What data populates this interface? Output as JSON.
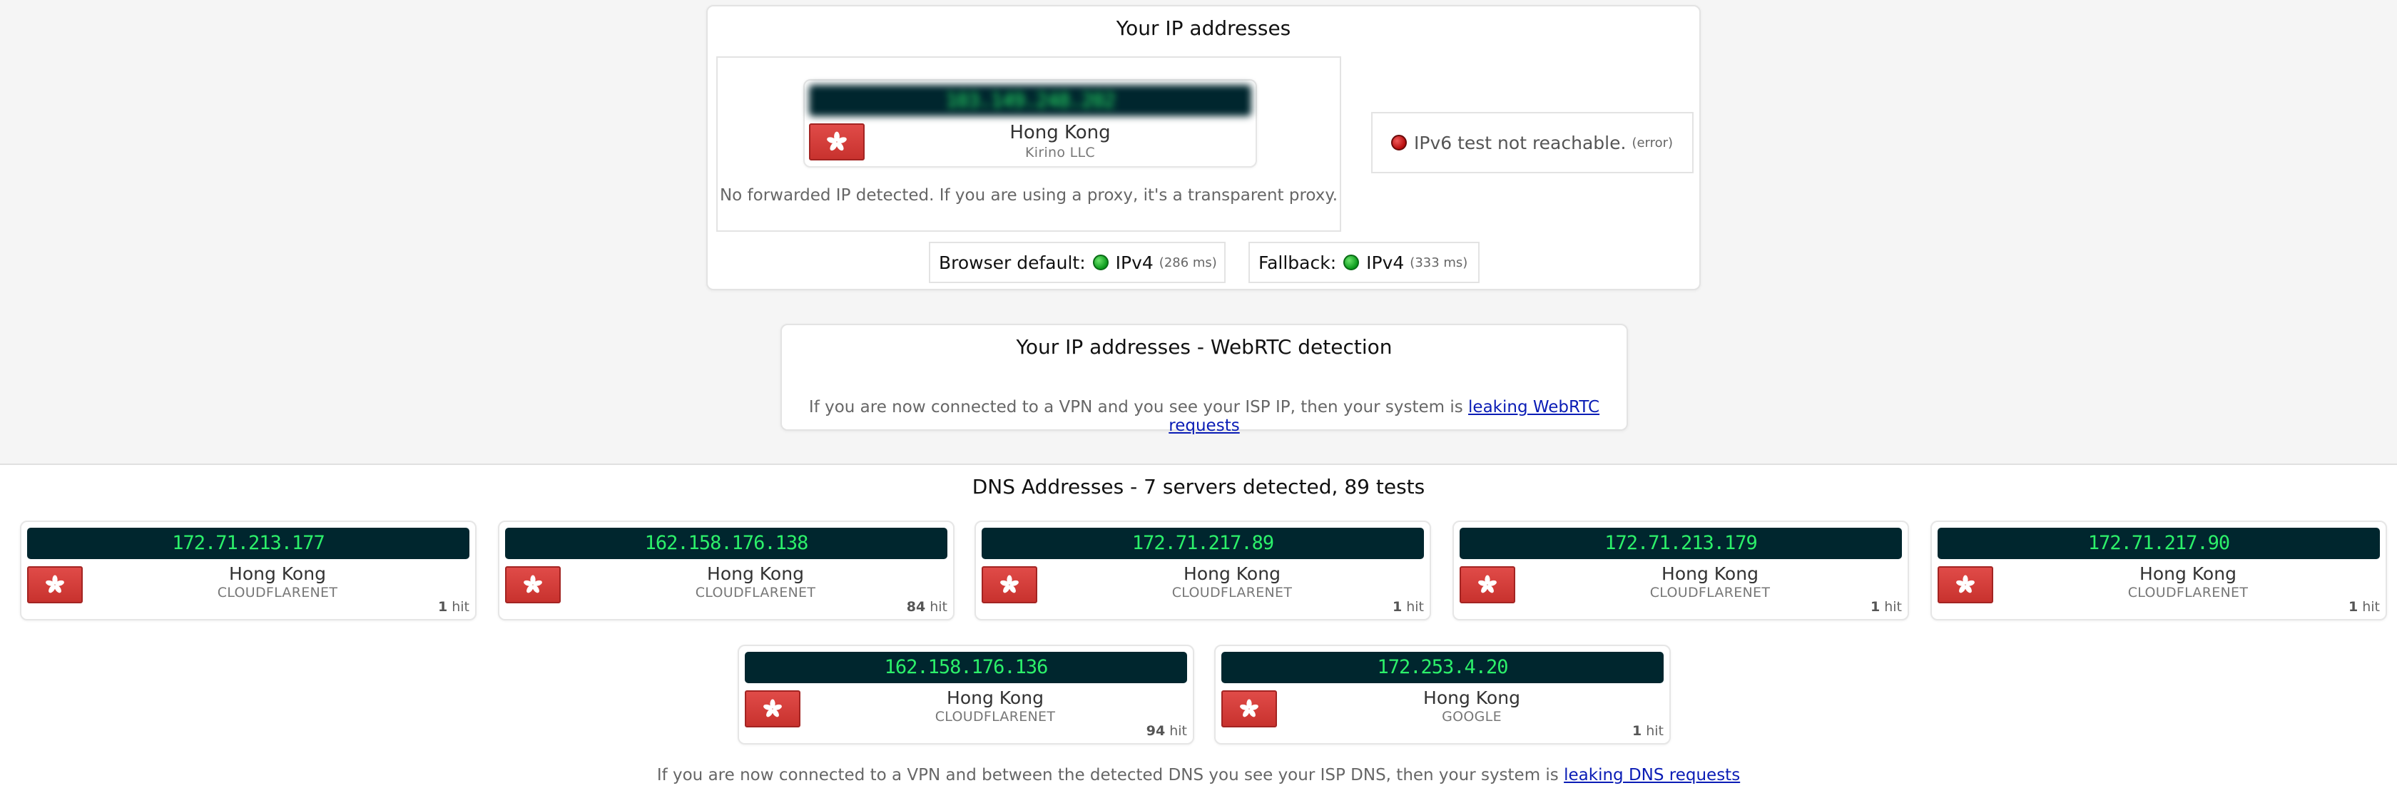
{
  "ip_section": {
    "title": "Your IP addresses",
    "ipv4": {
      "ip": "103.149.248.202",
      "country": "Hong Kong",
      "isp": "Kirino LLC"
    },
    "forwarded_note": "No forwarded IP detected. If you are using a proxy, it's a transparent proxy.",
    "ipv6": {
      "text": "IPv6 test not reachable.",
      "status": "(error)",
      "status_color": "#c00"
    },
    "browser_default": {
      "label": "Browser default:",
      "protocol": "IPv4",
      "latency": "(286 ms)"
    },
    "fallback": {
      "label": "Fallback:",
      "protocol": "IPv4",
      "latency": "(333 ms)"
    }
  },
  "webrtc_section": {
    "title": "Your IP addresses - WebRTC detection",
    "note_prefix": "If you are now connected to a VPN and you see your ISP IP, then your system is",
    "note_link": "leaking WebRTC requests"
  },
  "dns_section": {
    "title": "DNS Addresses - 7 servers detected, 89 tests",
    "servers": [
      {
        "ip": "172.71.213.177",
        "country": "Hong Kong",
        "isp": "CLOUDFLARENET",
        "hits": "1",
        "hit_label": "hit"
      },
      {
        "ip": "162.158.176.138",
        "country": "Hong Kong",
        "isp": "CLOUDFLARENET",
        "hits": "84",
        "hit_label": "hit"
      },
      {
        "ip": "172.71.217.89",
        "country": "Hong Kong",
        "isp": "CLOUDFLARENET",
        "hits": "1",
        "hit_label": "hit"
      },
      {
        "ip": "172.71.213.179",
        "country": "Hong Kong",
        "isp": "CLOUDFLARENET",
        "hits": "1",
        "hit_label": "hit"
      },
      {
        "ip": "172.71.217.90",
        "country": "Hong Kong",
        "isp": "CLOUDFLARENET",
        "hits": "1",
        "hit_label": "hit"
      },
      {
        "ip": "162.158.176.136",
        "country": "Hong Kong",
        "isp": "CLOUDFLARENET",
        "hits": "94",
        "hit_label": "hit"
      },
      {
        "ip": "172.253.4.20",
        "country": "Hong Kong",
        "isp": "GOOGLE",
        "hits": "1",
        "hit_label": "hit"
      }
    ],
    "note_prefix": "If you are now connected to a VPN and between the detected DNS you see your ISP DNS, then your system is",
    "note_link": "leaking DNS requests"
  },
  "colors": {
    "ip_bar_bg": "#00262e",
    "ip_text": "#2cf06a",
    "flag_red": "#d63f3b",
    "link": "#0a1cb5"
  },
  "icons": {
    "flag": "hong-kong-flag-icon",
    "status_ok": "green-dot-icon",
    "status_error": "red-dot-icon"
  }
}
